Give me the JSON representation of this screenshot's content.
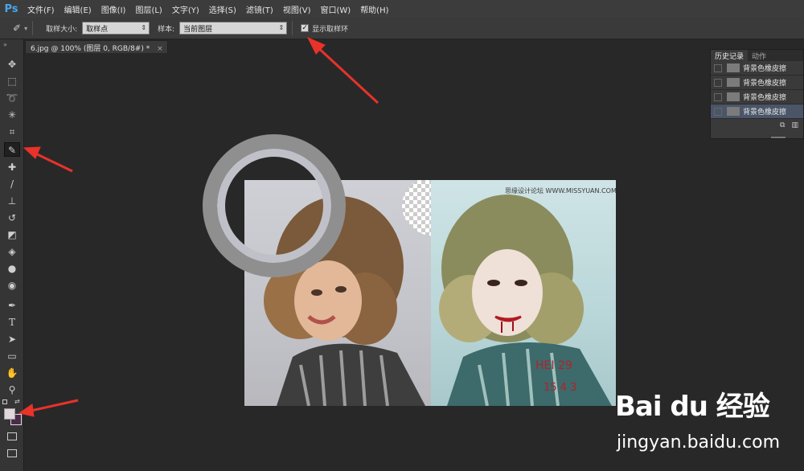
{
  "menubar": {
    "logo": "Ps",
    "items": [
      "文件(F)",
      "编辑(E)",
      "图像(I)",
      "图层(L)",
      "文字(Y)",
      "选择(S)",
      "滤镜(T)",
      "视图(V)",
      "窗口(W)",
      "帮助(H)"
    ]
  },
  "options": {
    "sample_size_label": "取样大小:",
    "sample_size_value": "取样点",
    "sample_label": "样本:",
    "sample_value": "当前图层",
    "show_ring_label": "显示取样环",
    "show_ring_checked": "✓"
  },
  "tab": {
    "title": "6.jpg @ 100% (图层 0, RGB/8#) *",
    "close": "×"
  },
  "history": {
    "tabs": [
      "历史记录",
      "动作"
    ],
    "items": [
      "背景色橡皮擦",
      "背景色橡皮擦",
      "背景色橡皮擦",
      "背景色橡皮擦"
    ]
  },
  "canvas": {
    "watermark": "思缘设计论坛  WWW.MISSYUAN.COM"
  },
  "baidu": {
    "logo": "Bai du 经验",
    "url": "jingyan.baidu.com"
  },
  "colors": {
    "accent": "#4aa6ea",
    "arrow": "#e8322a",
    "ring": "#8f8f90"
  },
  "tools": [
    "move-icon",
    "marquee-icon",
    "lasso-icon",
    "magic-wand-icon",
    "crop-icon",
    "eyedropper-icon",
    "healing-brush-icon",
    "brush-icon",
    "stamp-icon",
    "history-brush-icon",
    "eraser-icon",
    "paint-bucket-icon",
    "blur-icon",
    "dodge-icon",
    "pen-icon",
    "type-icon",
    "path-select-icon",
    "rectangle-icon",
    "hand-icon",
    "zoom-icon"
  ]
}
